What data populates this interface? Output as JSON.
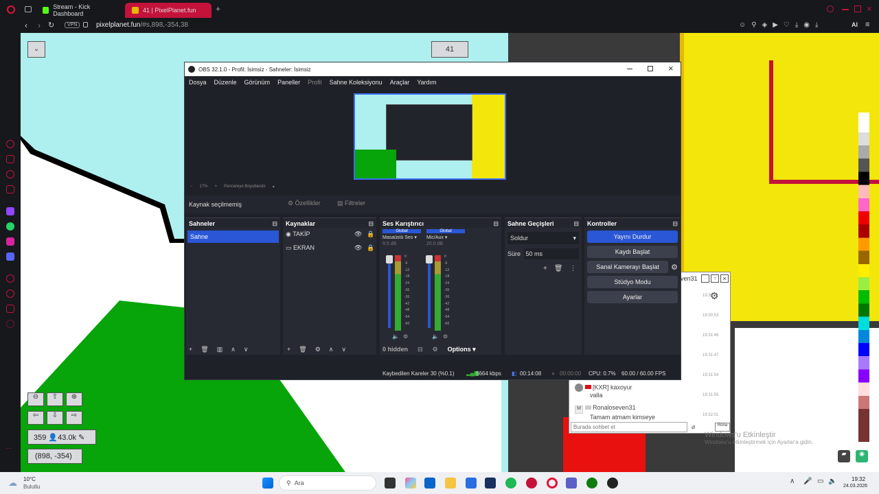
{
  "browser": {
    "tabs": [
      {
        "label": "Stream - Kick Dashboard",
        "icon": "kick-icon"
      },
      {
        "label": "41 | PixelPlanet.fun",
        "icon": "pixelplanet-icon"
      }
    ],
    "url": "pixelplanet.fun",
    "url_path": "/#s,898,-354,38",
    "vpn_label": "VPN",
    "ai_label": "AI",
    "accent": "#c4123b"
  },
  "pixel": {
    "online_count": "41",
    "counter": "359",
    "users": "43.0k",
    "coords": "(898, -354)"
  },
  "obs": {
    "title": "OBS 32.1.0 - Profil: İsimsiz - Sahneler: İsimsiz",
    "menu": [
      "Dosya",
      "Düzenle",
      "Görünüm",
      "Paneller",
      "Profil",
      "Sahne Koleksiyonu",
      "Araçlar",
      "Yardım"
    ],
    "zoom": "17%",
    "resize_label": "Pencereye Boyutlandır",
    "no_source": "Kaynak seçilmemiş",
    "properties": "Özellikler",
    "filters": "Filtreler",
    "scenes_title": "Sahneler",
    "scene_item": "Sahne",
    "sources_title": "Kaynaklar",
    "sources": [
      "TAKİP",
      "EKRAN"
    ],
    "mixer_title": "Ses Karıştırıcı",
    "channels": [
      {
        "tag": "Global",
        "name": "Masaüstü Ses",
        "db": "9.5 dB"
      },
      {
        "tag": "Global",
        "name": "Mic/Aux",
        "db": "20.0 dB"
      }
    ],
    "meter_ticks": [
      "0",
      "-6",
      "-12",
      "-18",
      "-24",
      "-30",
      "-36",
      "-42",
      "-48",
      "-54",
      "-60"
    ],
    "hidden_label": "0 hidden",
    "options_label": "Options",
    "transitions_title": "Sahne Geçişleri",
    "transition": "Soldur",
    "duration_label": "Süre",
    "duration": "50 ms",
    "controls_title": "Kontroller",
    "controls": [
      "Yayını Durdur",
      "Kaydı Başlat",
      "Sanal Kamerayı Başlat",
      "Stüdyo Modu",
      "Ayarlar"
    ],
    "status": {
      "dropped": "Kaybedilen Kareler 30 (%0.1)",
      "bitrate": "6664 kbps",
      "live_time": "00:14:08",
      "rec_time": "00:00:00",
      "cpu": "CPU: 0.7%",
      "fps": "60.00 / 60.00 FPS"
    }
  },
  "chat": {
    "tab_label": "ven31",
    "times": [
      "19:30:51",
      "19:30:53",
      "19:31:46",
      "19:31:47",
      "19:31:54",
      "19:31:55",
      "19:32:01"
    ],
    "messages": [
      {
        "user": "[KXR] kaxoyur",
        "text": "valla"
      },
      {
        "user": "Ronaloseven31",
        "text": "Tamam atmam kimseye"
      }
    ],
    "placeholder": "Burada sohbet et",
    "send_label": "Rona"
  },
  "watermark": {
    "line1": "Windows'u Etkinleştir",
    "line2": "Windows'u etkinleştirmek için Ayarlar'a gidin."
  },
  "taskbar": {
    "weather_temp": "10°C",
    "weather_text": "Bulutlu",
    "search": "Ara",
    "time": "19:32",
    "date": "24.03.2026"
  }
}
